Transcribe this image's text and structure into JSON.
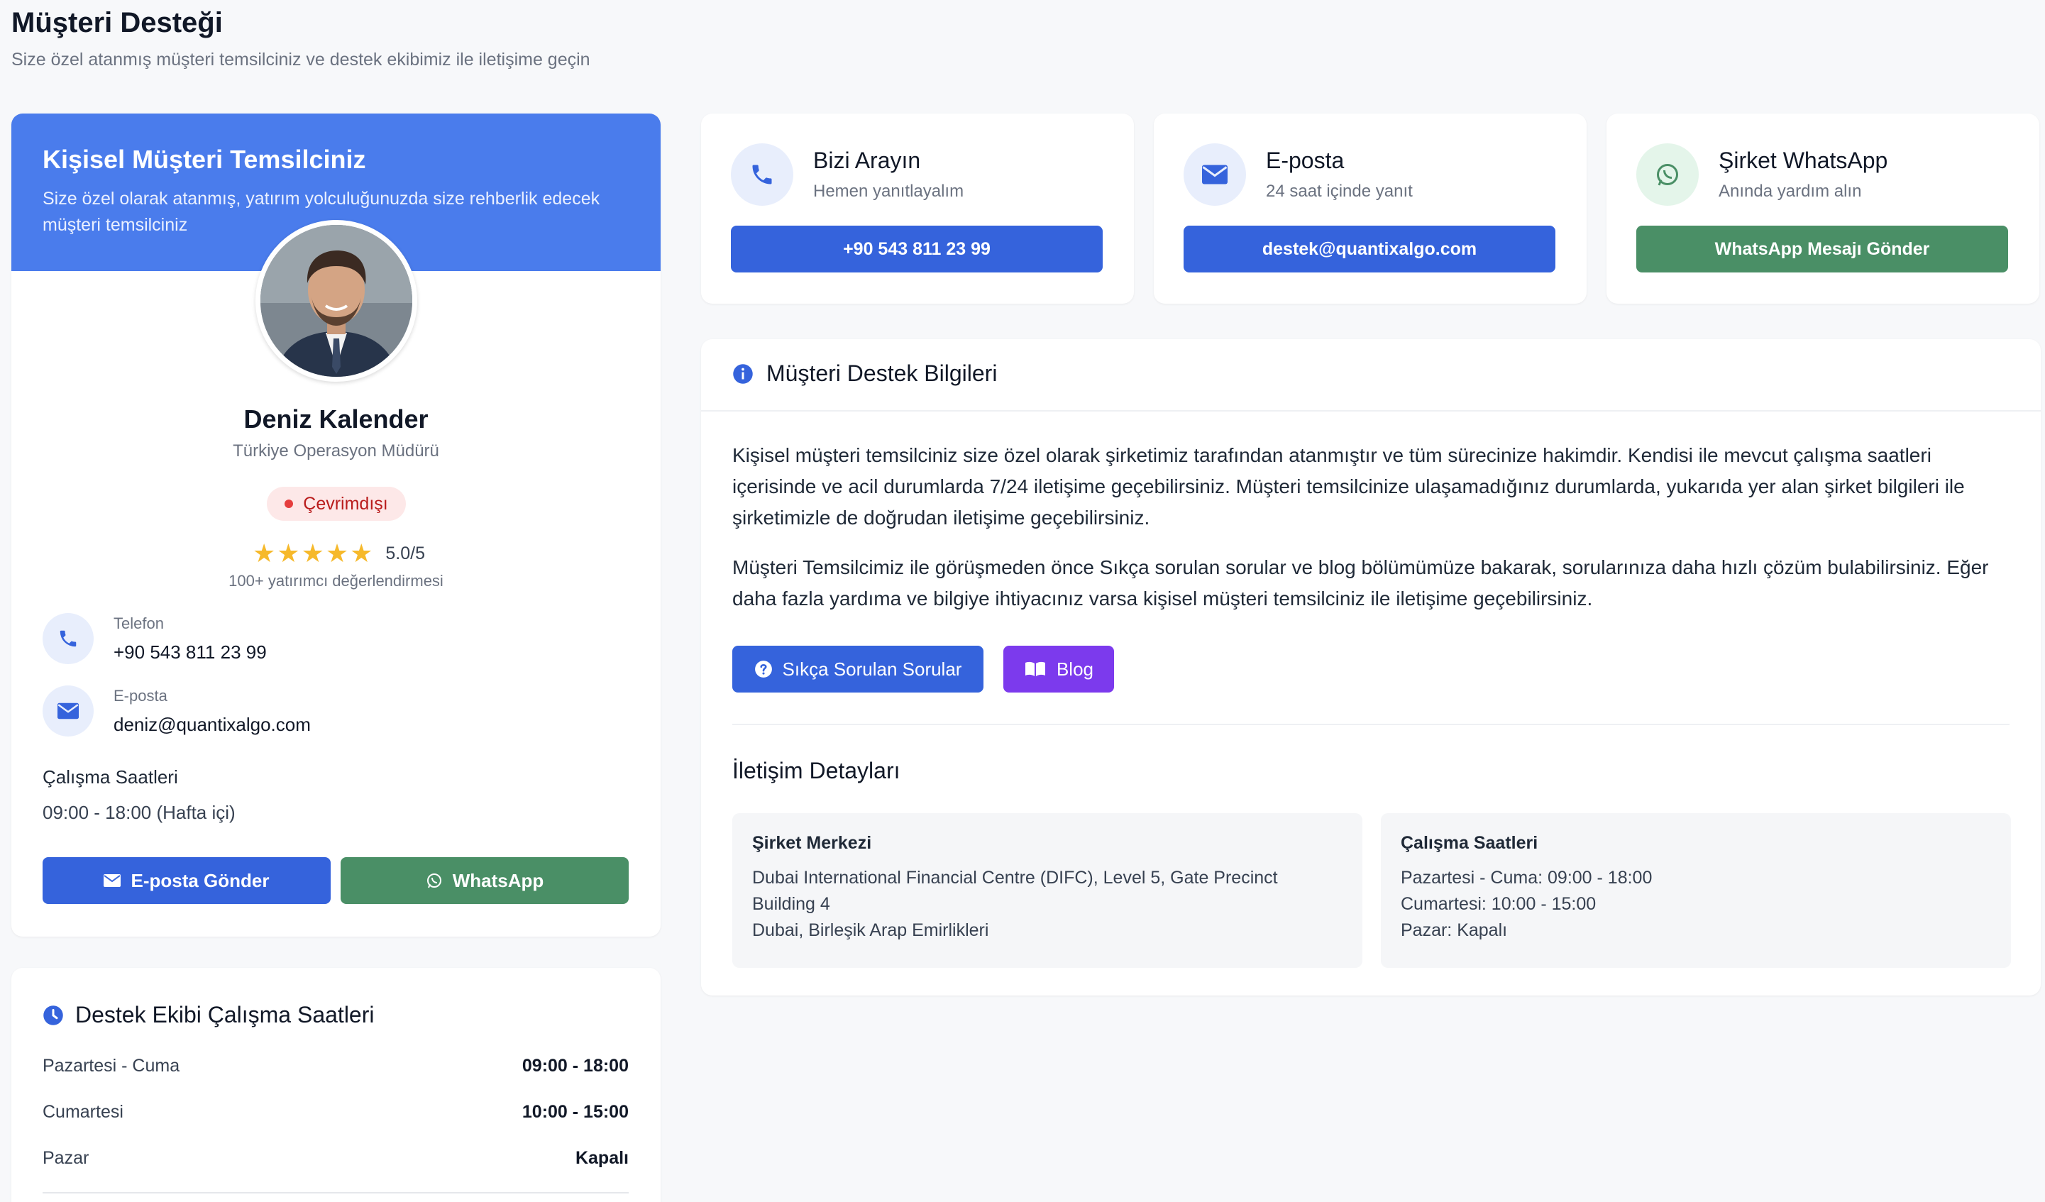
{
  "header": {
    "title": "Müşteri Desteği",
    "subtitle": "Size özel atanmış müşteri temsilciniz ve destek ekibimiz ile iletişime geçin"
  },
  "representative": {
    "card_title": "Kişisel Müşteri Temsilciniz",
    "card_desc": "Size özel olarak atanmış, yatırım yolculuğunuzda size rehberlik edecek müşteri temsilciniz",
    "name": "Deniz Kalender",
    "role": "Türkiye Operasyon Müdürü",
    "status": "Çevrimdışı",
    "rating": "5.0/5",
    "stars": 5,
    "rating_sub": "100+ yatırımcı değerlendirmesi",
    "phone_label": "Telefon",
    "phone": "+90 543 811 23 99",
    "email_label": "E-posta",
    "email": "deniz@quantixalgo.com",
    "hours_label": "Çalışma Saatleri",
    "hours": "09:00 - 18:00 (Hafta içi)",
    "email_button": "E-posta Gönder",
    "whatsapp_button": "WhatsApp"
  },
  "support_hours": {
    "title": "Destek Ekibi Çalışma Saatleri",
    "rows": [
      {
        "day": "Pazartesi - Cuma",
        "time": "09:00 - 18:00"
      },
      {
        "day": "Cumartesi",
        "time": "10:00 - 15:00"
      },
      {
        "day": "Pazar",
        "time": "Kapalı"
      }
    ]
  },
  "contact_cards": [
    {
      "title": "Bizi Arayın",
      "subtitle": "Hemen yanıtlayalım",
      "button": "+90 543 811 23 99",
      "icon": "phone-icon"
    },
    {
      "title": "E-posta",
      "subtitle": "24 saat içinde yanıt",
      "button": "destek@quantixalgo.com",
      "icon": "mail-icon"
    },
    {
      "title": "Şirket WhatsApp",
      "subtitle": "Anında yardım alın",
      "button": "WhatsApp Mesajı Gönder",
      "icon": "whatsapp-icon"
    }
  ],
  "info": {
    "title": "Müşteri Destek Bilgileri",
    "para1": "Kişisel müşteri temsilciniz size özel olarak şirketimiz tarafından atanmıştır ve tüm sürecinize hakimdir. Kendisi ile mevcut çalışma saatleri içerisinde ve acil durumlarda 7/24 iletişime geçebilirsiniz. Müşteri temsilcinize ulaşamadığınız durumlarda, yukarıda yer alan şirket bilgileri ile şirketimizle de doğrudan iletişime geçebilirsiniz.",
    "para2": "Müşteri Temsilcimiz ile görüşmeden önce Sıkça sorulan sorular ve blog bölümümüze bakarak, sorularınıza daha hızlı çözüm bulabilirsiniz. Eğer daha fazla yardıma ve bilgiye ihtiyacınız varsa kişisel müşteri temsilciniz ile iletişime geçebilirsiniz.",
    "faq_button": "Sıkça Sorulan Sorular",
    "blog_button": "Blog",
    "details_title": "İletişim Detayları",
    "hq": {
      "title": "Şirket Merkezi",
      "lines": [
        "Dubai International Financial Centre (DIFC), Level 5, Gate Precinct",
        "Building 4",
        "Dubai, Birleşik Arap Emirlikleri"
      ]
    },
    "hours": {
      "title": "Çalışma Saatleri",
      "lines": [
        "Pazartesi - Cuma: 09:00 - 18:00",
        "Cumartesi: 10:00 - 15:00",
        "Pazar: Kapalı"
      ]
    }
  },
  "colors": {
    "primary": "#3563dc",
    "header_blue": "#4a7cec",
    "whatsapp_green": "#4a8f66",
    "purple": "#7c3aed",
    "star": "#f6b92b"
  }
}
